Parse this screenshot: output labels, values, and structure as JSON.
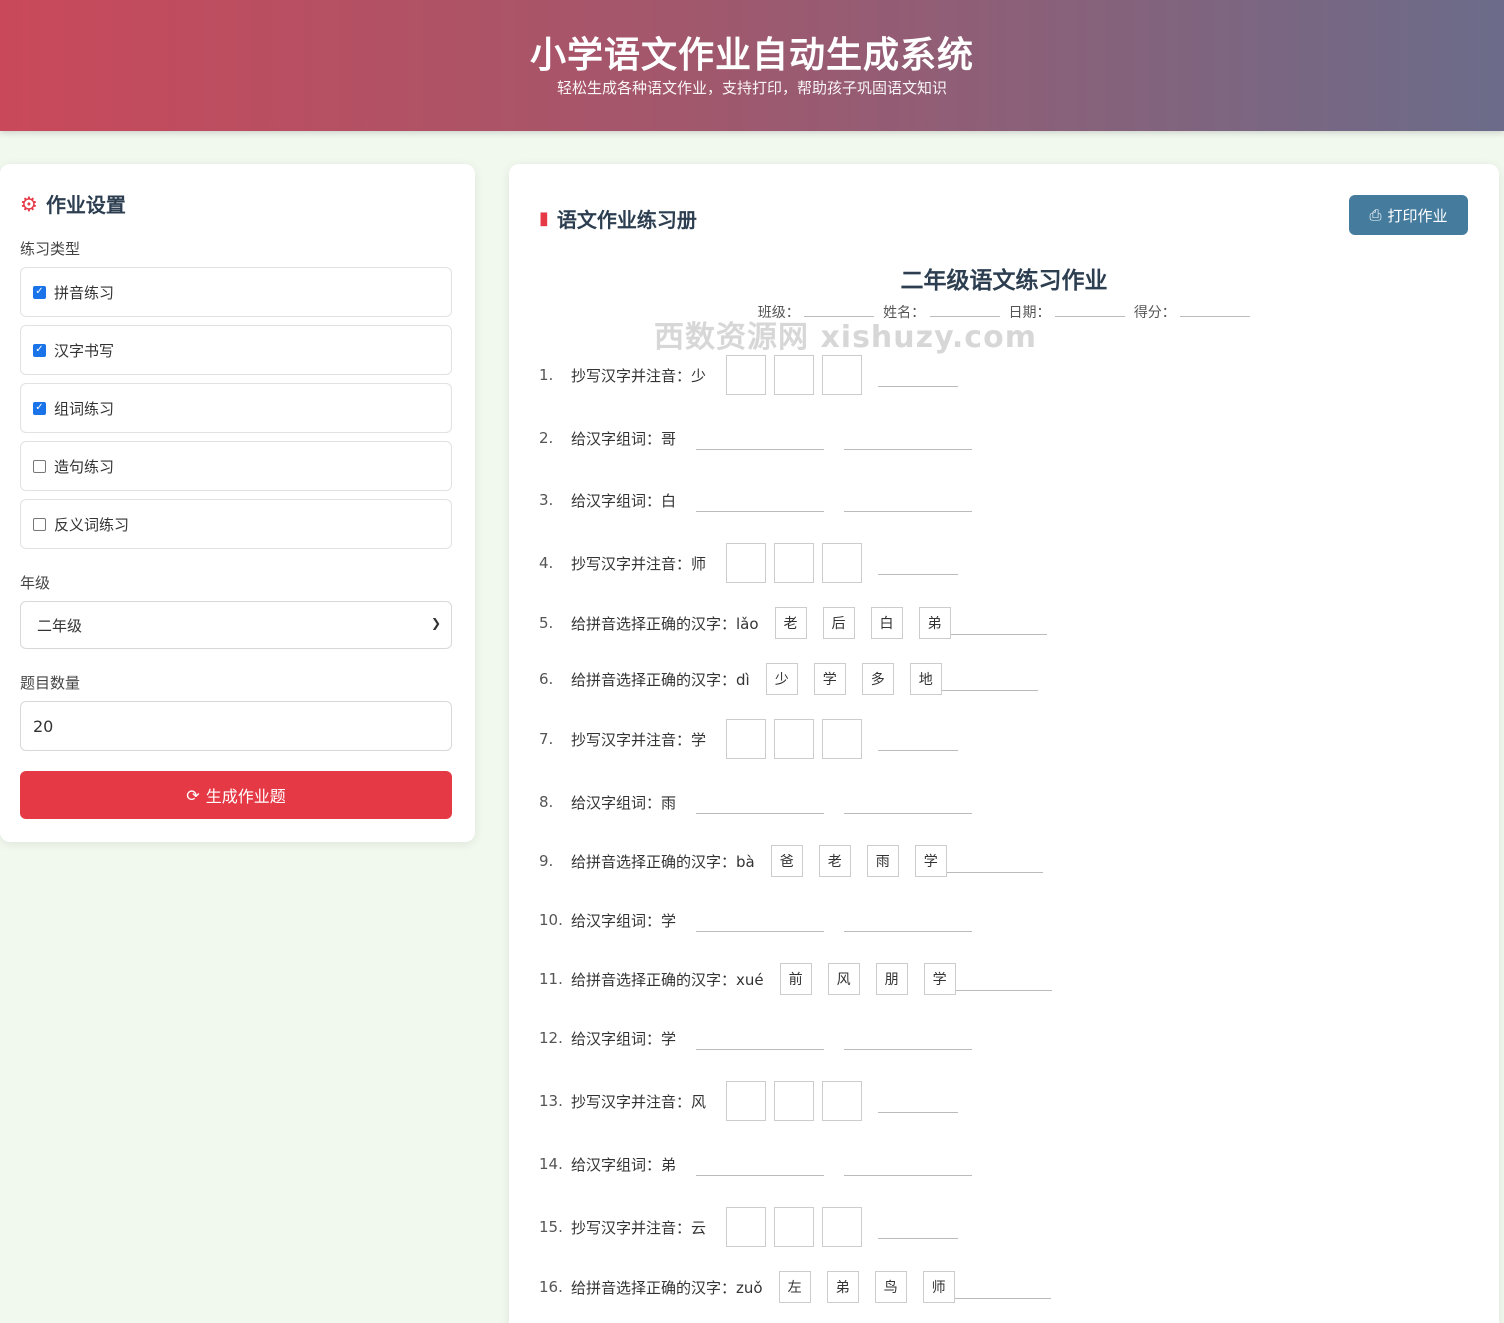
{
  "header": {
    "title": "小学语文作业自动生成系统",
    "subtitle": "轻松生成各种语文作业，支持打印，帮助孩子巩固语文知识"
  },
  "settings": {
    "title": "作业设置",
    "type_label": "练习类型",
    "types": [
      {
        "label": "拼音练习",
        "checked": true
      },
      {
        "label": "汉字书写",
        "checked": true
      },
      {
        "label": "组词练习",
        "checked": true
      },
      {
        "label": "造句练习",
        "checked": false
      },
      {
        "label": "反义词练习",
        "checked": false
      }
    ],
    "grade_label": "年级",
    "grade_value": "二年级",
    "count_label": "题目数量",
    "count_value": "20",
    "generate_label": "生成作业题"
  },
  "workbook": {
    "title": "语文作业练习册",
    "print_label": "打印作业",
    "sheet_title": "二年级语文练习作业",
    "meta": {
      "class": "班级：",
      "name": "姓名：",
      "date": "日期：",
      "score": "得分："
    },
    "watermark": "西数资源网 xishuzy.com",
    "questions": [
      {
        "no": "1.",
        "text": "抄写汉字并注音：少",
        "kind": "write"
      },
      {
        "no": "2.",
        "text": "给汉字组词：哥",
        "kind": "words"
      },
      {
        "no": "3.",
        "text": "给汉字组词：白",
        "kind": "words"
      },
      {
        "no": "4.",
        "text": "抄写汉字并注音：师",
        "kind": "write"
      },
      {
        "no": "5.",
        "text": "给拼音选择正确的汉字：lǎo",
        "kind": "choose",
        "options": [
          "老",
          "后",
          "白",
          "弟"
        ]
      },
      {
        "no": "6.",
        "text": "给拼音选择正确的汉字：dì",
        "kind": "choose",
        "options": [
          "少",
          "学",
          "多",
          "地"
        ]
      },
      {
        "no": "7.",
        "text": "抄写汉字并注音：学",
        "kind": "write"
      },
      {
        "no": "8.",
        "text": "给汉字组词：雨",
        "kind": "words"
      },
      {
        "no": "9.",
        "text": "给拼音选择正确的汉字：bà",
        "kind": "choose",
        "options": [
          "爸",
          "老",
          "雨",
          "学"
        ]
      },
      {
        "no": "10.",
        "text": "给汉字组词：学",
        "kind": "words"
      },
      {
        "no": "11.",
        "text": "给拼音选择正确的汉字：xué",
        "kind": "choose",
        "options": [
          "前",
          "风",
          "朋",
          "学"
        ]
      },
      {
        "no": "12.",
        "text": "给汉字组词：学",
        "kind": "words"
      },
      {
        "no": "13.",
        "text": "抄写汉字并注音：风",
        "kind": "write"
      },
      {
        "no": "14.",
        "text": "给汉字组词：弟",
        "kind": "words"
      },
      {
        "no": "15.",
        "text": "抄写汉字并注音：云",
        "kind": "write"
      },
      {
        "no": "16.",
        "text": "给拼音选择正确的汉字：zuǒ",
        "kind": "choose",
        "options": [
          "左",
          "弟",
          "鸟",
          "师"
        ]
      }
    ]
  }
}
